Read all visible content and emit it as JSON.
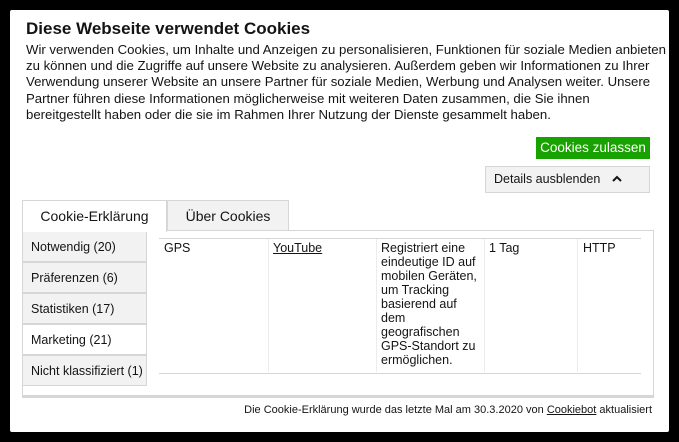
{
  "dialog": {
    "title": "Diese Webseite verwendet Cookies",
    "description": "Wir verwenden Cookies, um Inhalte und Anzeigen zu personalisieren, Funktionen für soziale Medien anbieten zu können und die Zugriffe auf unsere Website zu analysieren. Außerdem geben wir Informationen zu Ihrer Verwendung unserer Website an unsere Partner für soziale Medien, Werbung und Analysen weiter. Unsere Partner führen diese Informationen möglicherweise mit weiteren Daten zusammen, die Sie ihnen bereitgestellt haben oder die sie im Rahmen Ihrer Nutzung der Dienste gesammelt haben.",
    "allow_button": "Cookies zulassen",
    "details_button": "Details ausblenden",
    "details_icon": "chevron-up-icon",
    "accent_color": "#18a200"
  },
  "tabs": [
    {
      "label": "Cookie-Erklärung",
      "active": true
    },
    {
      "label": "Über Cookies",
      "active": false
    }
  ],
  "categories": [
    {
      "label": "Notwendig (20)"
    },
    {
      "label": "Präferenzen (6)"
    },
    {
      "label": "Statistiken (17)"
    },
    {
      "label": "Marketing (21)",
      "active": true
    },
    {
      "label": "Nicht klassifiziert (1)"
    }
  ],
  "cookie_row": {
    "name": "GPS",
    "provider": "YouTube",
    "purpose": "Registriert eine eindeutige ID auf mobilen Geräten, um Tracking basierend auf dem geografischen GPS-Standort zu ermöglichen.",
    "expiry": "1 Tag",
    "type": "HTTP"
  },
  "footer": {
    "text_before": "Die Cookie-Erklärung wurde das letzte Mal am 30.3.2020 von",
    "link": "Cookiebot",
    "text_after": "aktualisiert"
  }
}
